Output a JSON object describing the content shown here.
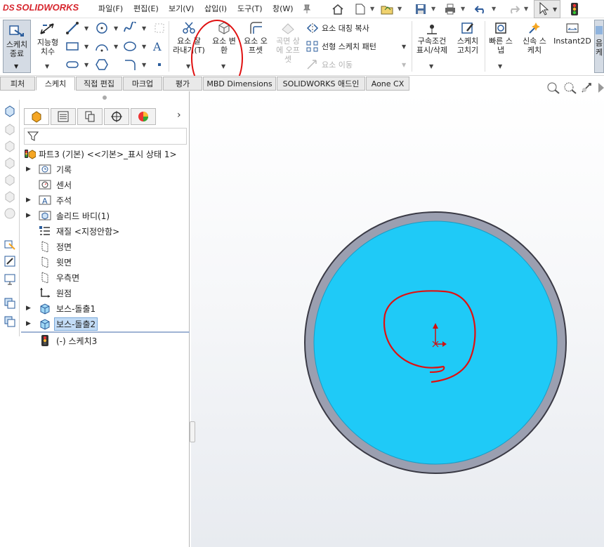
{
  "app": {
    "logo_prefix": "DS",
    "logo_text": "SOLIDWORKS"
  },
  "menu": [
    "파일(F)",
    "편집(E)",
    "보기(V)",
    "삽입(I)",
    "도구(T)",
    "창(W)"
  ],
  "command_manager": {
    "exit_sketch_line1": "스케치",
    "exit_sketch_line2": "종료",
    "smart_dim_line1": "지능형",
    "smart_dim_line2": "치수",
    "trim_line1": "요소 잘",
    "trim_line2": "라내기(T)",
    "convert_line1": "요소 변",
    "convert_line2": "환",
    "offset_line1": "요소 오",
    "offset_line2": "프셋",
    "surface_offset_line1": "곡면 상",
    "surface_offset_line2": "에 오프",
    "surface_offset_line3": "셋",
    "mirror": "요소 대칭 복사",
    "linear_pattern": "선형 스케치 패턴",
    "move_entities": "요소 이동",
    "relations_line1": "구속조건",
    "relations_line2": "표시/삭제",
    "repair_line1": "스케치",
    "repair_line2": "고치기",
    "quick_snaps_line1": "빠른 스",
    "quick_snaps_line2": "냅",
    "rapid_sketch_line1": "신속 스",
    "rapid_sketch_line2": "케치",
    "instant2d": "Instant2D",
    "shaded_line1": "음",
    "shaded_line2": "케"
  },
  "tabs": [
    "피처",
    "스케치",
    "직접 편집",
    "마크업",
    "평가",
    "MBD Dimensions",
    "SOLIDWORKS 애드인",
    "Aone CX"
  ],
  "active_tab_index": 1,
  "tree": {
    "root": "파트3 (기본) <<기본>_표시 상태 1>",
    "items": [
      {
        "label": "기록",
        "icon": "history-icon",
        "expandable": true
      },
      {
        "label": "센서",
        "icon": "sensor-icon",
        "expandable": false
      },
      {
        "label": "주석",
        "icon": "annotations-icon",
        "expandable": true
      },
      {
        "label": "솔리드 바디(1)",
        "icon": "solid-bodies-icon",
        "expandable": true
      },
      {
        "label": "재질 <지정안함>",
        "icon": "material-icon",
        "expandable": false
      },
      {
        "label": "정면",
        "icon": "plane-icon",
        "expandable": false
      },
      {
        "label": "윗면",
        "icon": "plane-icon",
        "expandable": false
      },
      {
        "label": "우측면",
        "icon": "plane-icon",
        "expandable": false
      },
      {
        "label": "원점",
        "icon": "origin-icon",
        "expandable": false
      },
      {
        "label": "보스-돌출1",
        "icon": "extrude-icon",
        "expandable": true
      },
      {
        "label": "보스-돌출2",
        "icon": "extrude-icon",
        "expandable": true,
        "selected": true
      },
      {
        "label": "(-) 스케치3",
        "icon": "sketch-icon",
        "expandable": false
      }
    ]
  },
  "colors": {
    "brand_red": "#d7262e",
    "face_blue": "#1fcaf7",
    "edge_gray": "#9b9fb0",
    "annotation_red": "#e01010",
    "selection_blue": "#c3dcf6"
  }
}
